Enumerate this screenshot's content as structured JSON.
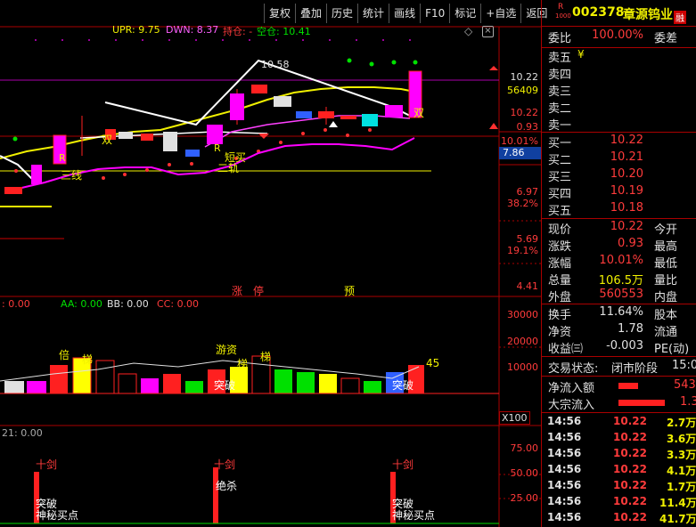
{
  "toolbar": {
    "buttons": [
      "复权",
      "叠加",
      "历史",
      "统计",
      "画线",
      "F10",
      "标记",
      "+自选",
      "返回"
    ]
  },
  "indicators": {
    "main": {
      "upr_label": "UPR: 9.75",
      "dwn_label": "DWN: 8.37",
      "hold_label": "持仓: -",
      "empty_label": "空仓: 10.41"
    },
    "vol": {
      "prefix": ": 0.00",
      "aa": "AA: 0.00",
      "bb": "BB: 0.00",
      "cc": "CC: 0.00"
    },
    "sub": {
      "prefix": "21: 0.00"
    },
    "x100": "X100"
  },
  "main_axis": {
    "labels": [
      "10.22",
      "56409",
      "10.22",
      "0.93",
      "10.01%",
      "7.86",
      "6.97",
      "38.2%",
      "5.69",
      "19.1%",
      "4.41"
    ]
  },
  "vol_axis": {
    "labels": [
      "30000",
      "20000",
      "10000"
    ]
  },
  "sub_axis": {
    "labels": [
      "75.00",
      "50.00",
      "25.00"
    ]
  },
  "chart_annotations": {
    "price_top": "10.58",
    "r1": "R",
    "r2": "R",
    "shuang1": "双",
    "shuang2": "双",
    "sanxian": "三线",
    "duan": "短买",
    "ergui": "二轨",
    "zhang": "涨",
    "ting": "停",
    "yu": "预",
    "bei": "倍",
    "ti1": "梯",
    "youzi": "游资",
    "ti2": "梯",
    "tupo1": "突破",
    "tupo2": "突破",
    "ti3": "梯",
    "num45": "45",
    "shijian1": "十剑",
    "shijian2": "十剑",
    "shijian3": "十剑",
    "tupo3": "突破",
    "mimi1": "神秘买点",
    "juesha": "绝杀",
    "tupo4": "突破",
    "mimi2": "神秘买点"
  },
  "panel": {
    "code": "002378",
    "name": "章源钨业",
    "badge_r": "R",
    "badge_1000": "1000",
    "badge_rong": "融",
    "weibi_label": "委比",
    "weibi_value": "100.00%",
    "weicha_label": "委差",
    "sell": [
      {
        "label": "卖五",
        "value": "¥"
      },
      {
        "label": "卖四",
        "value": ""
      },
      {
        "label": "卖三",
        "value": ""
      },
      {
        "label": "卖二",
        "value": ""
      },
      {
        "label": "卖一",
        "value": ""
      }
    ],
    "buy": [
      {
        "label": "买一",
        "value": "10.22"
      },
      {
        "label": "买二",
        "value": "10.21"
      },
      {
        "label": "买三",
        "value": "10.20"
      },
      {
        "label": "买四",
        "value": "10.19"
      },
      {
        "label": "买五",
        "value": "10.18"
      }
    ],
    "quote": [
      {
        "l1": "现价",
        "v1": "10.22",
        "l2": "今开"
      },
      {
        "l1": "涨跌",
        "v1": "0.93",
        "l2": "最高"
      },
      {
        "l1": "涨幅",
        "v1": "10.01%",
        "l2": "最低"
      },
      {
        "l1": "总量",
        "v1": "106.5万",
        "l2": "量比"
      },
      {
        "l1": "外盘",
        "v1": "560553",
        "l2": "内盘"
      }
    ],
    "stats": [
      {
        "l1": "换手",
        "v1": "11.64%",
        "l2": "股本"
      },
      {
        "l1": "净资",
        "v1": "1.78",
        "l2": "流通"
      },
      {
        "l1": "收益㈢",
        "v1": "-0.003",
        "l2": "PE(动)"
      }
    ],
    "trade_state_label": "交易状态:",
    "trade_state_value": "闭市阶段",
    "trade_state_time": "15:0",
    "net_inflow_label": "净流入额",
    "net_inflow_value": "543",
    "block_inflow_label": "大宗流入",
    "block_inflow_value": "1.3",
    "ticks": [
      {
        "time": "14:56",
        "price": "10.22",
        "vol": "2.7万"
      },
      {
        "time": "14:56",
        "price": "10.22",
        "vol": "3.6万"
      },
      {
        "time": "14:56",
        "price": "10.22",
        "vol": "3.3万"
      },
      {
        "time": "14:56",
        "price": "10.22",
        "vol": "4.1万"
      },
      {
        "time": "14:56",
        "price": "10.22",
        "vol": "1.7万"
      },
      {
        "time": "14:56",
        "price": "10.22",
        "vol": "11.4万"
      },
      {
        "time": "14:56",
        "price": "10.22",
        "vol": "41.7万"
      }
    ]
  },
  "colors": {
    "up": "#ff3b3b",
    "down": "#00e0e0",
    "yellow": "#f0f000",
    "magenta": "#ff00ff",
    "white": "#ffffff",
    "frame": "#aa0000"
  }
}
